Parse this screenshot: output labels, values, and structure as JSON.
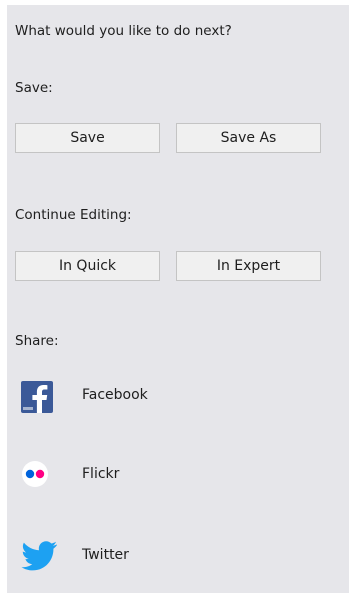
{
  "prompt": "What would you like to do next?",
  "save_section": {
    "heading": "Save:",
    "buttons": [
      "Save",
      "Save As"
    ]
  },
  "edit_section": {
    "heading": "Continue Editing:",
    "buttons": [
      "In Quick",
      "In Expert"
    ]
  },
  "share_section": {
    "heading": "Share:",
    "items": [
      {
        "label": "Facebook",
        "icon": "facebook-icon",
        "color": "#3b5998"
      },
      {
        "label": "Flickr",
        "icon": "flickr-icon",
        "colors": [
          "#0063dc",
          "#ff0084"
        ]
      },
      {
        "label": "Twitter",
        "icon": "twitter-icon",
        "color": "#1da1f2"
      }
    ]
  }
}
